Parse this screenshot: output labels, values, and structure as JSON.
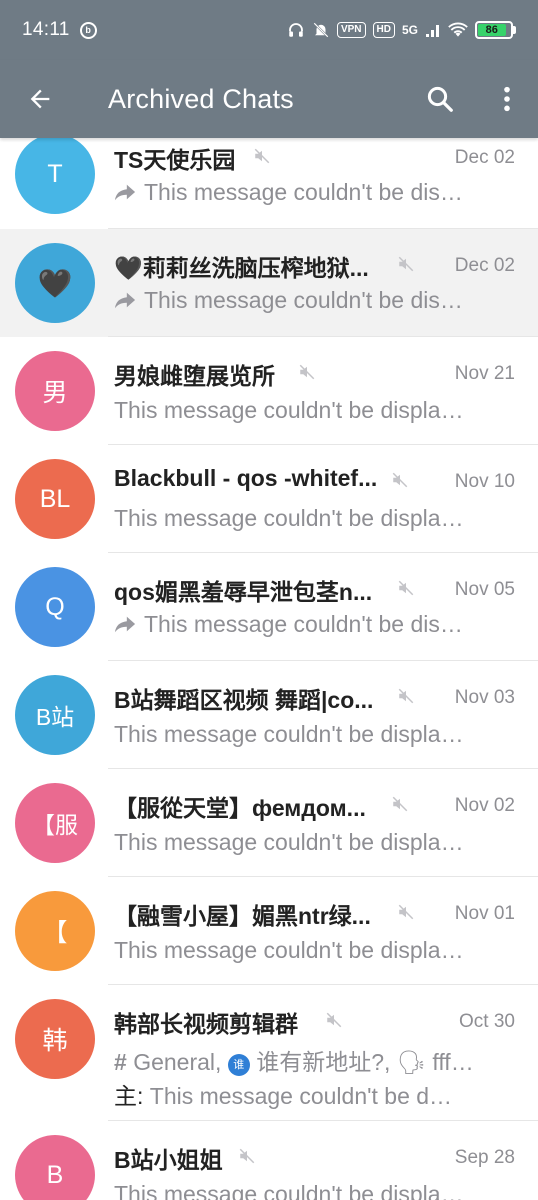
{
  "status_bar": {
    "time": "14:11",
    "vpn": "VPN",
    "hd": "HD",
    "network": "5G",
    "battery": "86",
    "battery_level_percent": 86,
    "icons": [
      "headphones-icon",
      "mute-bell-icon",
      "wifi-icon",
      "signal-icon",
      "battery-icon"
    ]
  },
  "app_bar": {
    "title": "Archived Chats",
    "back_icon": "arrow-back-icon",
    "search_icon": "search-icon",
    "menu_icon": "more-vertical-icon"
  },
  "colors": {
    "header": "#6f7b85",
    "name_text": "#222222",
    "secondary_text": "#8e8e93",
    "active_row": "#f2f2f2"
  },
  "chats": [
    {
      "avatar_text": "T",
      "avatar_color": "#47b6e6",
      "name": "TS天使乐园",
      "muted": true,
      "date": "Dec 02",
      "forwarded": true,
      "message": "This message couldn't be dis…"
    },
    {
      "avatar_text": "🖤",
      "avatar_color": "#3fa7d9",
      "name": "🖤莉莉丝洗脑压榨地狱...",
      "muted": true,
      "date": "Dec 02",
      "forwarded": true,
      "message": "This message couldn't be dis…"
    },
    {
      "avatar_text": "男",
      "avatar_color": "#ea6a90",
      "name": "男娘雌堕展览所",
      "muted": true,
      "date": "Nov 21",
      "forwarded": false,
      "message": "This message couldn't be displa…"
    },
    {
      "avatar_text": "BL",
      "avatar_color": "#ec6b4f",
      "name": "Blackbull - qos -whitef...",
      "muted": true,
      "date": "Nov 10",
      "forwarded": false,
      "message": "This message couldn't be displa…"
    },
    {
      "avatar_text": "Q",
      "avatar_color": "#4a93e3",
      "name": "qos媚黑羞辱早泄包茎n...",
      "muted": true,
      "date": "Nov 05",
      "forwarded": true,
      "message": "This message couldn't be dis…"
    },
    {
      "avatar_text": "B站",
      "avatar_color": "#3fa7d9",
      "name": "B站舞蹈区视频 舞蹈|co...",
      "muted": true,
      "date": "Nov 03",
      "forwarded": false,
      "message": "This message couldn't be displa…"
    },
    {
      "avatar_text": "【服",
      "avatar_color": "#ea6a90",
      "name": "【服從天堂】фемдом...",
      "muted": true,
      "date": "Nov 02",
      "forwarded": false,
      "message": "This message couldn't be displa…"
    },
    {
      "avatar_text": "【",
      "avatar_color": "#f89a3c",
      "name": "【融雪小屋】媚黑ntr绿...",
      "muted": true,
      "date": "Nov 01",
      "forwarded": false,
      "message": "This message couldn't be displa…"
    },
    {
      "avatar_text": "韩",
      "avatar_color": "#ec6b4f",
      "name": "韩部长视频剪辑群",
      "muted": true,
      "date": "Oct 30",
      "topics": {
        "hash": "#",
        "general": "General,",
        "topic2_badge": "谁",
        "topic2": "谁有新地址?,",
        "topic3_emoji": "🗣",
        "topic3": "fff…"
      },
      "author": "主:",
      "message": "This message couldn't be d…"
    },
    {
      "avatar_text": "B",
      "avatar_color": "#ea6a90",
      "name": "B站小姐姐",
      "muted": true,
      "date": "Sep 28",
      "forwarded": false,
      "message": "This message couldn't be displa…"
    }
  ]
}
